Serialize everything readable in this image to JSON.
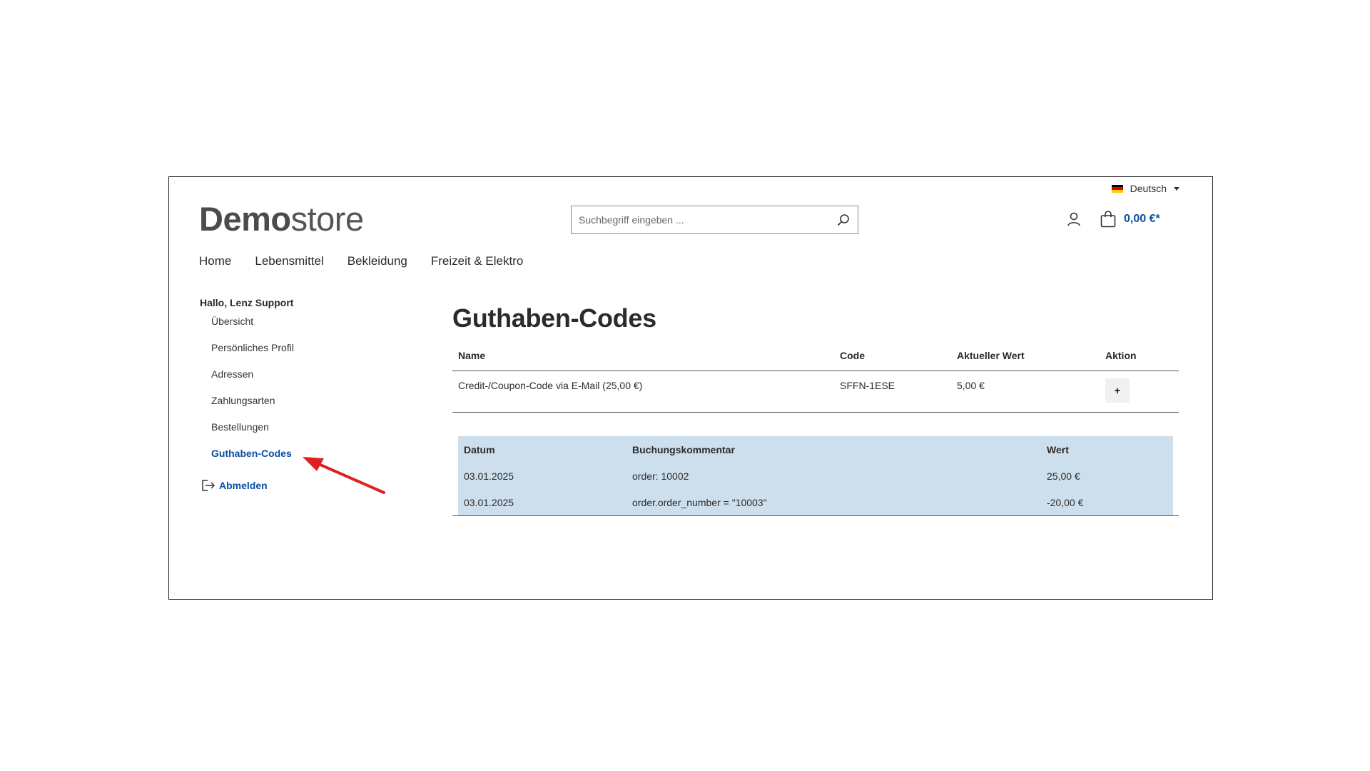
{
  "header": {
    "language": "Deutsch",
    "logo_bold": "Demo",
    "logo_light": "store",
    "search_placeholder": "Suchbegriff eingeben ...",
    "cart_total": "0,00 €*"
  },
  "nav": {
    "items": [
      "Home",
      "Lebensmittel",
      "Bekleidung",
      "Freizeit & Elektro"
    ]
  },
  "sidebar": {
    "greeting": "Hallo, Lenz Support",
    "items": [
      "Übersicht",
      "Persönliches Profil",
      "Adressen",
      "Zahlungsarten",
      "Bestellungen",
      "Guthaben-Codes"
    ],
    "active_index": 5,
    "logout": "Abmelden"
  },
  "main": {
    "title": "Guthaben-Codes",
    "table": {
      "headers": [
        "Name",
        "Code",
        "Aktueller Wert",
        "Aktion"
      ],
      "rows": [
        {
          "name": "Credit-/Coupon-Code via E-Mail (25,00 €)",
          "code": "SFFN-1ESE",
          "value": "5,00 €",
          "action": "+"
        }
      ]
    },
    "history": {
      "headers": [
        "Datum",
        "Buchungskommentar",
        "Wert"
      ],
      "rows": [
        {
          "date": "03.01.2025",
          "comment": "order: 10002",
          "value": "25,00 €"
        },
        {
          "date": "03.01.2025",
          "comment": "order.order_number = \"10003\"",
          "value": "-20,00 €"
        }
      ]
    }
  },
  "colors": {
    "accent": "#0b4ea2",
    "history_bg": "#cddfed",
    "annotation_arrow": "#e02020"
  }
}
